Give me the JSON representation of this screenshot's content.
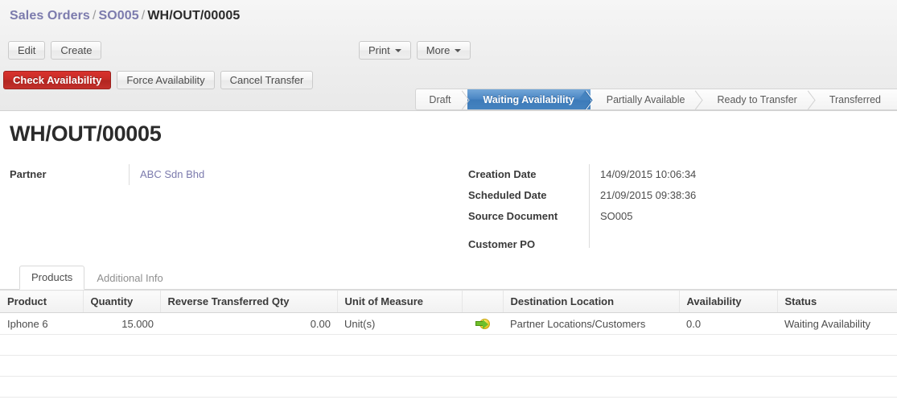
{
  "breadcrumb": {
    "root": "Sales Orders",
    "parent": "SO005",
    "current": "WH/OUT/00005",
    "separator": "/"
  },
  "toolbar": {
    "edit_label": "Edit",
    "create_label": "Create",
    "print_label": "Print",
    "more_label": "More"
  },
  "actions": {
    "check_availability_label": "Check Availability",
    "force_availability_label": "Force Availability",
    "cancel_transfer_label": "Cancel Transfer",
    "primary_color": "#c62b26"
  },
  "statusbar": {
    "active_color": "#4a86c4",
    "steps": [
      {
        "label": "Draft",
        "active": false
      },
      {
        "label": "Waiting Availability",
        "active": true
      },
      {
        "label": "Partially Available",
        "active": false
      },
      {
        "label": "Ready to Transfer",
        "active": false
      },
      {
        "label": "Transferred",
        "active": false
      }
    ]
  },
  "record": {
    "title": "WH/OUT/00005",
    "left_fields": [
      {
        "label": "Partner",
        "value": "ABC Sdn Bhd",
        "is_link": true
      }
    ],
    "right_fields": [
      {
        "label": "Creation Date",
        "value": "14/09/2015 10:06:34"
      },
      {
        "label": "Scheduled Date",
        "value": "21/09/2015 09:38:36"
      },
      {
        "label": "Source Document",
        "value": "SO005"
      },
      {
        "label": "Customer PO",
        "value": ""
      }
    ]
  },
  "notebook": {
    "tabs": [
      {
        "label": "Products",
        "active": true
      },
      {
        "label": "Additional Info",
        "active": false
      }
    ]
  },
  "products_table": {
    "columns": [
      "Product",
      "Quantity",
      "Reverse Transferred Qty",
      "Unit of Measure",
      "",
      "Destination Location",
      "Availability",
      "Status"
    ],
    "rows": [
      {
        "product": "Iphone 6",
        "quantity": "15.000",
        "reverse_transferred_qty": "0.00",
        "unit_of_measure": "Unit(s)",
        "icon": "transfer-icon",
        "destination_location": "Partner Locations/Customers",
        "availability": "0.0",
        "status": "Waiting Availability"
      }
    ],
    "empty_row_count": 3
  }
}
